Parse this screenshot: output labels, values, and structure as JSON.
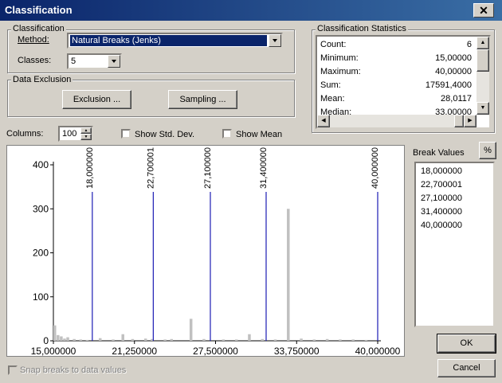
{
  "window": {
    "title": "Classification",
    "close": "✕"
  },
  "classification": {
    "group_title": "Classification",
    "method_label": "Method:",
    "method_value": "Natural Breaks (Jenks)",
    "classes_label": "Classes:",
    "classes_value": "5"
  },
  "data_exclusion": {
    "group_title": "Data Exclusion",
    "exclusion_button": "Exclusion ...",
    "sampling_button": "Sampling ..."
  },
  "statistics": {
    "group_title": "Classification Statistics",
    "rows": [
      {
        "label": "Count:",
        "value": "6"
      },
      {
        "label": "Minimum:",
        "value": "15,00000"
      },
      {
        "label": "Maximum:",
        "value": "40,00000"
      },
      {
        "label": "Sum:",
        "value": "17591,4000"
      },
      {
        "label": "Mean:",
        "value": "28,0117"
      },
      {
        "label": "Median:",
        "value": "33,00000"
      }
    ]
  },
  "columns": {
    "label": "Columns:",
    "value": "100"
  },
  "show_std_dev": {
    "label": "Show Std. Dev.",
    "checked": false
  },
  "show_mean": {
    "label": "Show Mean",
    "checked": false
  },
  "chart_data": {
    "type": "bar",
    "xlim": [
      15,
      40
    ],
    "ylim": [
      0,
      400
    ],
    "x_ticks": [
      "15,000000",
      "21,250000",
      "27,500000",
      "33,750000",
      "40,000000"
    ],
    "x_tick_values": [
      15,
      21.25,
      27.5,
      33.75,
      40
    ],
    "y_ticks": [
      "0",
      "100",
      "200",
      "300",
      "400"
    ],
    "y_tick_values": [
      0,
      100,
      200,
      300,
      400
    ],
    "bars": [
      {
        "x": 15.0,
        "value": 35
      },
      {
        "x": 15.25,
        "value": 13
      },
      {
        "x": 15.5,
        "value": 10
      },
      {
        "x": 15.75,
        "value": 5
      },
      {
        "x": 16.0,
        "value": 8
      },
      {
        "x": 16.5,
        "value": 4
      },
      {
        "x": 17.0,
        "value": 3
      },
      {
        "x": 17.5,
        "value": 2
      },
      {
        "x": 18.5,
        "value": 6
      },
      {
        "x": 19.5,
        "value": 3
      },
      {
        "x": 20.25,
        "value": 15
      },
      {
        "x": 21.0,
        "value": 4
      },
      {
        "x": 22.0,
        "value": 5
      },
      {
        "x": 22.5,
        "value": 4
      },
      {
        "x": 23.5,
        "value": 3
      },
      {
        "x": 24.0,
        "value": 4
      },
      {
        "x": 25.5,
        "value": 50
      },
      {
        "x": 26.5,
        "value": 4
      },
      {
        "x": 28.0,
        "value": 3
      },
      {
        "x": 29.0,
        "value": 3
      },
      {
        "x": 30.0,
        "value": 15
      },
      {
        "x": 31.0,
        "value": 4
      },
      {
        "x": 32.0,
        "value": 3
      },
      {
        "x": 33.0,
        "value": 300
      },
      {
        "x": 34.0,
        "value": 5
      },
      {
        "x": 35.0,
        "value": 3
      },
      {
        "x": 36.0,
        "value": 4
      },
      {
        "x": 37.0,
        "value": 3
      },
      {
        "x": 38.0,
        "value": 3
      },
      {
        "x": 39.0,
        "value": 2
      }
    ],
    "break_lines": [
      18.0,
      22.700001,
      27.1,
      31.4,
      40.0
    ],
    "break_labels": [
      "18,000000",
      "22,700001",
      "27,100000",
      "31,400000",
      "40,000000"
    ],
    "colors": {
      "bar": "#c0c0c0",
      "break_line": "#1c1cb4"
    }
  },
  "break_values": {
    "label": "Break Values",
    "percent_button": "%",
    "items": [
      "18,000000",
      "22,700001",
      "27,100000",
      "31,400000",
      "40,000000"
    ]
  },
  "ok_button": "OK",
  "cancel_button": "Cancel",
  "snap": {
    "label": "Snap breaks to data values",
    "enabled": false
  }
}
